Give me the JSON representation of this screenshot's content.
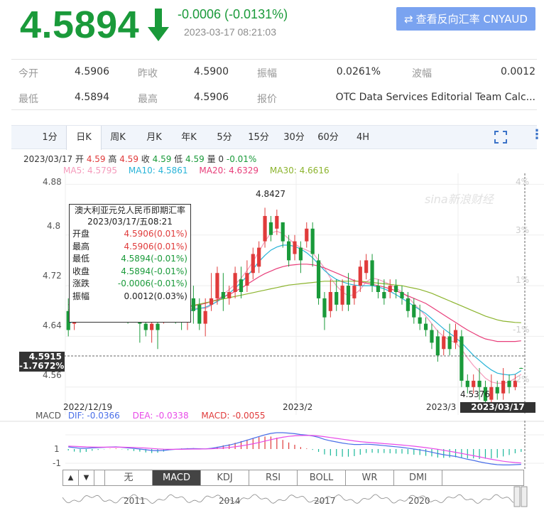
{
  "header": {
    "price": "4.5894",
    "change": "-0.0006 (-0.0131%)",
    "timestamp": "2023-03-17 08:21:03",
    "reverse_button": "查看反向汇率 CNYAUD",
    "colors": {
      "down": "#1a9a3a",
      "up": "#e03b3b",
      "button": "#7aa3f0"
    }
  },
  "quote": {
    "row1": [
      {
        "label": "今开",
        "value": "4.5906"
      },
      {
        "label": "昨收",
        "value": "4.5900"
      },
      {
        "label": "振幅",
        "value": "0.0261%"
      },
      {
        "label": "波幅",
        "value": "0.0012"
      }
    ],
    "row2": [
      {
        "label": "最低",
        "value": "4.5894"
      },
      {
        "label": "最高",
        "value": "4.5906"
      },
      {
        "label": "报价",
        "value": "OTC Data Services Editorial Team Calc..."
      }
    ]
  },
  "tabs": [
    "1分",
    "日K",
    "周K",
    "月K",
    "年K",
    "5分",
    "15分",
    "30分",
    "60分",
    "4H"
  ],
  "active_tab": "日K",
  "kline_info": {
    "date": "2023/03/17",
    "open_label": "开",
    "open": "4.59",
    "high_label": "高",
    "high": "4.59",
    "close_label": "收",
    "close": "4.59",
    "low_label": "低",
    "low": "4.59",
    "vol_label": "量",
    "vol": "0",
    "pct": "-0.01%"
  },
  "ma": [
    {
      "label": "MA5: 4.5795",
      "color": "#f59abb"
    },
    {
      "label": "MA10: 4.5861",
      "color": "#28b4d8"
    },
    {
      "label": "MA20: 4.6329",
      "color": "#e83e7a"
    },
    {
      "label": "MA30: 4.6616",
      "color": "#8cb42e"
    }
  ],
  "tooltip": {
    "title": "澳大利亚元兑人民币即期汇率",
    "date": "2023/03/17/五08:21",
    "rows": [
      {
        "label": "开盘",
        "value": "4.5906(0.01%)",
        "tone": "red"
      },
      {
        "label": "最高",
        "value": "4.5906(0.01%)",
        "tone": "red"
      },
      {
        "label": "最低",
        "value": "4.5894(-0.01%)",
        "tone": "green"
      },
      {
        "label": "收盘",
        "value": "4.5894(-0.01%)",
        "tone": "green"
      },
      {
        "label": "涨跌",
        "value": "-0.0006(-0.01%)",
        "tone": "green"
      },
      {
        "label": "振幅",
        "value": "0.0012(0.03%)",
        "tone": "plain"
      }
    ]
  },
  "cursor": {
    "price": "4.5915",
    "pct": "-1.7672%",
    "time": "2023/03/17 08:21"
  },
  "watermark": "sina新浪财经",
  "chart_data": {
    "type": "candlestick",
    "y_ticks": [
      "4.88",
      "4.8",
      "4.72",
      "4.64",
      "4.56"
    ],
    "y_ticks_right": [
      "4%",
      "3%",
      "1%",
      "-1%",
      "-2%"
    ],
    "x_labels": [
      "2022/12/19",
      "2023/2",
      "2023/3"
    ],
    "annotations": {
      "high": "4.8427",
      "low": "4.5376"
    },
    "ylim": [
      4.525,
      4.895
    ],
    "candles": [
      [
        4.68,
        4.65,
        4.7,
        4.64
      ],
      [
        4.66,
        4.67,
        4.69,
        4.65
      ],
      [
        4.7,
        4.69,
        4.72,
        4.68
      ],
      [
        4.68,
        4.69,
        4.71,
        4.67
      ],
      [
        4.69,
        4.7,
        4.72,
        4.68
      ],
      [
        4.7,
        4.69,
        4.72,
        4.68
      ],
      [
        4.7,
        4.71,
        4.73,
        4.69
      ],
      [
        4.69,
        4.7,
        4.71,
        4.67
      ],
      [
        4.7,
        4.72,
        4.73,
        4.69
      ],
      [
        4.71,
        4.69,
        4.72,
        4.68
      ],
      [
        4.69,
        4.68,
        4.7,
        4.66
      ],
      [
        4.69,
        4.68,
        4.71,
        4.67
      ],
      [
        4.67,
        4.66,
        4.69,
        4.63
      ],
      [
        4.66,
        4.65,
        4.67,
        4.64
      ],
      [
        4.65,
        4.66,
        4.68,
        4.63
      ],
      [
        4.66,
        4.65,
        4.68,
        4.62
      ],
      [
        4.67,
        4.68,
        4.72,
        4.66
      ],
      [
        4.71,
        4.69,
        4.73,
        4.67
      ],
      [
        4.7,
        4.68,
        4.71,
        4.66
      ],
      [
        4.68,
        4.67,
        4.7,
        4.65
      ],
      [
        4.67,
        4.69,
        4.72,
        4.65
      ],
      [
        4.7,
        4.68,
        4.72,
        4.66
      ],
      [
        4.69,
        4.66,
        4.7,
        4.65
      ],
      [
        4.66,
        4.68,
        4.7,
        4.64
      ],
      [
        4.69,
        4.7,
        4.74,
        4.68
      ],
      [
        4.7,
        4.74,
        4.75,
        4.69
      ],
      [
        4.71,
        4.7,
        4.74,
        4.68
      ],
      [
        4.7,
        4.71,
        4.72,
        4.69
      ],
      [
        4.71,
        4.74,
        4.75,
        4.7
      ],
      [
        4.73,
        4.71,
        4.75,
        4.7
      ],
      [
        4.72,
        4.74,
        4.76,
        4.71
      ],
      [
        4.74,
        4.77,
        4.78,
        4.73
      ],
      [
        4.75,
        4.78,
        4.79,
        4.74
      ],
      [
        4.79,
        4.83,
        4.843,
        4.78
      ],
      [
        4.82,
        4.8,
        4.83,
        4.79
      ],
      [
        4.81,
        4.83,
        4.84,
        4.8
      ],
      [
        4.82,
        4.79,
        4.82,
        4.78
      ],
      [
        4.79,
        4.76,
        4.8,
        4.75
      ],
      [
        4.77,
        4.79,
        4.8,
        4.76
      ],
      [
        4.78,
        4.76,
        4.79,
        4.74
      ],
      [
        4.79,
        4.81,
        4.82,
        4.78
      ],
      [
        4.81,
        4.77,
        4.82,
        4.75
      ],
      [
        4.76,
        4.7,
        4.77,
        4.69
      ],
      [
        4.7,
        4.67,
        4.71,
        4.65
      ],
      [
        4.68,
        4.71,
        4.73,
        4.67
      ],
      [
        4.71,
        4.69,
        4.73,
        4.68
      ],
      [
        4.69,
        4.72,
        4.73,
        4.68
      ],
      [
        4.72,
        4.69,
        4.74,
        4.68
      ],
      [
        4.7,
        4.72,
        4.73,
        4.69
      ],
      [
        4.72,
        4.75,
        4.76,
        4.71
      ],
      [
        4.74,
        4.76,
        4.77,
        4.73
      ],
      [
        4.76,
        4.72,
        4.77,
        4.71
      ],
      [
        4.72,
        4.71,
        4.73,
        4.7
      ],
      [
        4.71,
        4.7,
        4.73,
        4.69
      ],
      [
        4.71,
        4.72,
        4.73,
        4.7
      ],
      [
        4.72,
        4.71,
        4.73,
        4.7
      ],
      [
        4.71,
        4.7,
        4.72,
        4.69
      ],
      [
        4.7,
        4.68,
        4.71,
        4.67
      ],
      [
        4.69,
        4.67,
        4.7,
        4.66
      ],
      [
        4.67,
        4.66,
        4.69,
        4.65
      ],
      [
        4.66,
        4.65,
        4.67,
        4.64
      ],
      [
        4.65,
        4.63,
        4.66,
        4.62
      ],
      [
        4.64,
        4.61,
        4.65,
        4.6
      ],
      [
        4.62,
        4.64,
        4.65,
        4.61
      ],
      [
        4.64,
        4.62,
        4.66,
        4.61
      ],
      [
        4.63,
        4.65,
        4.66,
        4.62
      ],
      [
        4.64,
        4.57,
        4.65,
        4.56
      ],
      [
        4.57,
        4.56,
        4.58,
        4.55
      ],
      [
        4.56,
        4.57,
        4.58,
        4.55
      ],
      [
        4.57,
        4.56,
        4.59,
        4.54
      ],
      [
        4.56,
        4.538,
        4.57,
        4.53
      ],
      [
        4.54,
        4.56,
        4.58,
        4.53
      ],
      [
        4.56,
        4.55,
        4.57,
        4.54
      ],
      [
        4.55,
        4.57,
        4.59,
        4.54
      ],
      [
        4.57,
        4.56,
        4.58,
        4.55
      ],
      [
        4.56,
        4.57,
        4.58,
        4.555
      ],
      [
        4.59,
        4.5894,
        4.5906,
        4.5894
      ]
    ],
    "ma_series": {
      "MA5": [
        4.67,
        4.675,
        4.68,
        4.683,
        4.686,
        4.69,
        4.692,
        4.694,
        4.695,
        4.694,
        4.69,
        4.687,
        4.682,
        4.676,
        4.671,
        4.668,
        4.671,
        4.676,
        4.678,
        4.679,
        4.682,
        4.684,
        4.685,
        4.684,
        4.689,
        4.696,
        4.706,
        4.714,
        4.722,
        4.732,
        4.744,
        4.758,
        4.774,
        4.79,
        4.803,
        4.806,
        4.802,
        4.794,
        4.786,
        4.78,
        4.776,
        4.772,
        4.76,
        4.748,
        4.732,
        4.72,
        4.71,
        4.704,
        4.706,
        4.714,
        4.726,
        4.732,
        4.73,
        4.726,
        4.722,
        4.716,
        4.71,
        4.702,
        4.692,
        4.682,
        4.672,
        4.66,
        4.648,
        4.64,
        4.634,
        4.63,
        4.62,
        4.606,
        4.594,
        4.584,
        4.574,
        4.568,
        4.566,
        4.566,
        4.568,
        4.574,
        4.58
      ],
      "MA10": [
        4.66,
        4.664,
        4.668,
        4.672,
        4.676,
        4.68,
        4.683,
        4.686,
        4.688,
        4.689,
        4.688,
        4.686,
        4.684,
        4.681,
        4.678,
        4.676,
        4.675,
        4.675,
        4.676,
        4.677,
        4.679,
        4.682,
        4.684,
        4.686,
        4.69,
        4.695,
        4.701,
        4.708,
        4.716,
        4.725,
        4.735,
        4.746,
        4.758,
        4.768,
        4.776,
        4.781,
        4.784,
        4.784,
        4.782,
        4.778,
        4.772,
        4.764,
        4.754,
        4.744,
        4.736,
        4.73,
        4.726,
        4.723,
        4.721,
        4.72,
        4.72,
        4.72,
        4.718,
        4.715,
        4.711,
        4.706,
        4.7,
        4.694,
        4.688,
        4.682,
        4.676,
        4.668,
        4.66,
        4.652,
        4.645,
        4.638,
        4.63,
        4.62,
        4.61,
        4.602,
        4.594,
        4.587,
        4.582,
        4.58,
        4.579,
        4.58,
        4.586
      ],
      "MA20": [
        4.69,
        4.691,
        4.692,
        4.692,
        4.692,
        4.692,
        4.692,
        4.692,
        4.692,
        4.692,
        4.691,
        4.69,
        4.689,
        4.688,
        4.687,
        4.686,
        4.686,
        4.686,
        4.686,
        4.686,
        4.687,
        4.688,
        4.69,
        4.692,
        4.695,
        4.698,
        4.702,
        4.706,
        4.711,
        4.716,
        4.722,
        4.728,
        4.734,
        4.739,
        4.743,
        4.747,
        4.75,
        4.752,
        4.753,
        4.754,
        4.754,
        4.753,
        4.751,
        4.748,
        4.744,
        4.74,
        4.736,
        4.732,
        4.728,
        4.726,
        4.724,
        4.722,
        4.72,
        4.718,
        4.715,
        4.712,
        4.708,
        4.704,
        4.7,
        4.696,
        4.692,
        4.686,
        4.68,
        4.674,
        4.668,
        4.662,
        4.656,
        4.65,
        4.645,
        4.64,
        4.636,
        4.634,
        4.632,
        4.632,
        4.632,
        4.632,
        4.633
      ],
      "MA30": [
        4.682,
        4.682,
        4.682,
        4.682,
        4.682,
        4.682,
        4.682,
        4.682,
        4.682,
        4.682,
        4.682,
        4.682,
        4.682,
        4.682,
        4.682,
        4.682,
        4.682,
        4.683,
        4.684,
        4.685,
        4.687,
        4.689,
        4.691,
        4.693,
        4.695,
        4.697,
        4.699,
        4.701,
        4.703,
        4.705,
        4.707,
        4.709,
        4.711,
        4.713,
        4.715,
        4.717,
        4.719,
        4.721,
        4.722,
        4.723,
        4.724,
        4.725,
        4.726,
        4.727,
        4.727,
        4.727,
        4.727,
        4.727,
        4.727,
        4.727,
        4.726,
        4.725,
        4.724,
        4.723,
        4.722,
        4.721,
        4.72,
        4.718,
        4.716,
        4.714,
        4.711,
        4.708,
        4.704,
        4.7,
        4.696,
        4.692,
        4.688,
        4.684,
        4.68,
        4.676,
        4.672,
        4.669,
        4.666,
        4.664,
        4.663,
        4.662,
        4.6616
      ]
    }
  },
  "macd": {
    "label": "MACD",
    "dif": "DIF: -0.0366",
    "dea": "DEA: -0.0338",
    "macd": "MACD: -0.0055",
    "y_ticks": [
      "1",
      "-1"
    ],
    "colors": {
      "dif": "#4a6fe8",
      "dea": "#e84ae8",
      "macd": "#e03b3b"
    },
    "dif_values": [
      0.15,
      0.1,
      0.05,
      0.05,
      0.08,
      0.1,
      0.12,
      0.14,
      0.15,
      0.12,
      0.08,
      0.04,
      0.0,
      -0.05,
      -0.1,
      -0.12,
      -0.1,
      -0.05,
      -0.02,
      0.0,
      0.02,
      0.03,
      0.02,
      0.01,
      0.05,
      0.12,
      0.2,
      0.28,
      0.38,
      0.5,
      0.62,
      0.75,
      0.88,
      1.0,
      1.1,
      1.15,
      1.15,
      1.12,
      1.08,
      1.02,
      0.98,
      0.92,
      0.82,
      0.68,
      0.58,
      0.5,
      0.42,
      0.36,
      0.32,
      0.32,
      0.34,
      0.32,
      0.28,
      0.24,
      0.2,
      0.16,
      0.12,
      0.06,
      0.0,
      -0.06,
      -0.14,
      -0.22,
      -0.32,
      -0.4,
      -0.46,
      -0.52,
      -0.62,
      -0.72,
      -0.8,
      -0.9,
      -0.98,
      -1.05,
      -1.1,
      -1.12,
      -1.12,
      -1.1,
      -1.08
    ],
    "dea_values": [
      0.2,
      0.19,
      0.17,
      0.15,
      0.14,
      0.13,
      0.13,
      0.13,
      0.13,
      0.13,
      0.12,
      0.11,
      0.09,
      0.07,
      0.04,
      0.01,
      -0.01,
      -0.02,
      -0.02,
      -0.02,
      -0.01,
      0.0,
      0.0,
      0.01,
      0.02,
      0.04,
      0.07,
      0.11,
      0.16,
      0.22,
      0.29,
      0.37,
      0.46,
      0.56,
      0.66,
      0.75,
      0.83,
      0.89,
      0.93,
      0.95,
      0.96,
      0.95,
      0.92,
      0.87,
      0.81,
      0.75,
      0.69,
      0.63,
      0.57,
      0.52,
      0.48,
      0.45,
      0.42,
      0.38,
      0.35,
      0.32,
      0.28,
      0.24,
      0.2,
      0.15,
      0.1,
      0.04,
      -0.02,
      -0.09,
      -0.16,
      -0.23,
      -0.31,
      -0.39,
      -0.47,
      -0.55,
      -0.64,
      -0.72,
      -0.79,
      -0.86,
      -0.91,
      -0.95,
      -0.98
    ]
  },
  "indicators": {
    "arrows": [
      "▲",
      "▼"
    ],
    "tabs": [
      "无",
      "MACD",
      "KDJ",
      "RSI",
      "BOLL",
      "WR",
      "DMI"
    ],
    "active": "MACD"
  },
  "navigator": {
    "years": [
      "2011",
      "2014",
      "2017",
      "2020"
    ]
  }
}
